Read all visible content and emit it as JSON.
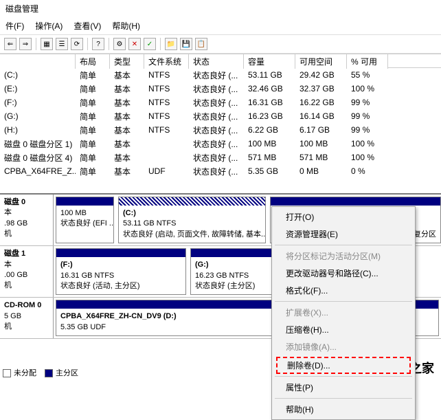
{
  "title": "磁盘管理",
  "menu": {
    "file": "件(F)",
    "action": "操作(A)",
    "view": "查看(V)",
    "help": "帮助(H)"
  },
  "cols": {
    "vol": "",
    "layout": "布局",
    "type": "类型",
    "fs": "文件系统",
    "status": "状态",
    "cap": "容量",
    "free": "可用空间",
    "pct": "% 可用"
  },
  "rows": [
    {
      "vol": "(C:)",
      "layout": "简单",
      "type": "基本",
      "fs": "NTFS",
      "status": "状态良好 (...",
      "cap": "53.11 GB",
      "free": "29.42 GB",
      "pct": "55 %"
    },
    {
      "vol": "(E:)",
      "layout": "简单",
      "type": "基本",
      "fs": "NTFS",
      "status": "状态良好 (...",
      "cap": "32.46 GB",
      "free": "32.37 GB",
      "pct": "100 %"
    },
    {
      "vol": "(F:)",
      "layout": "简单",
      "type": "基本",
      "fs": "NTFS",
      "status": "状态良好 (...",
      "cap": "16.31 GB",
      "free": "16.22 GB",
      "pct": "99 %"
    },
    {
      "vol": "(G:)",
      "layout": "简单",
      "type": "基本",
      "fs": "NTFS",
      "status": "状态良好 (...",
      "cap": "16.23 GB",
      "free": "16.14 GB",
      "pct": "99 %"
    },
    {
      "vol": "(H:)",
      "layout": "简单",
      "type": "基本",
      "fs": "NTFS",
      "status": "状态良好 (...",
      "cap": "6.22 GB",
      "free": "6.17 GB",
      "pct": "99 %"
    },
    {
      "vol": "磁盘 0 磁盘分区 1)",
      "layout": "简单",
      "type": "基本",
      "fs": "",
      "status": "状态良好 (...",
      "cap": "100 MB",
      "free": "100 MB",
      "pct": "100 %"
    },
    {
      "vol": "磁盘 0 磁盘分区 4)",
      "layout": "简单",
      "type": "基本",
      "fs": "",
      "status": "状态良好 (...",
      "cap": "571 MB",
      "free": "571 MB",
      "pct": "100 %"
    },
    {
      "vol": "CPBA_X64FRE_Z...",
      "layout": "简单",
      "type": "基本",
      "fs": "UDF",
      "status": "状态良好 (...",
      "cap": "5.35 GB",
      "free": "0 MB",
      "pct": "0 %"
    }
  ],
  "disk0": {
    "name": "磁盘 0",
    "type": "本",
    "size": ".98 GB",
    "state": "机",
    "p1": {
      "size": "100 MB",
      "status": "状态良好 (EFI ..."
    },
    "p2": {
      "letter": "(C:)",
      "size": "53.11 GB NTFS",
      "status": "状态良好 (启动, 页面文件, 故障转储, 基本..."
    },
    "p3": {
      "status": "状态良好 (恢复分区"
    }
  },
  "disk1": {
    "name": "磁盘 1",
    "type": "本",
    "size": ".00 GB",
    "state": "机",
    "p1": {
      "letter": "(F:)",
      "size": "16.31 GB NTFS",
      "status": "状态良好 (活动, 主分区)"
    },
    "p2": {
      "letter": "(G:)",
      "size": "16.23 GB NTFS",
      "status": "状态良好 (主分区)"
    }
  },
  "cdrom": {
    "name": "CD-ROM 0",
    "type": "",
    "size": "5 GB",
    "state": "机",
    "p1": {
      "label": "CPBA_X64FRE_ZH-CN_DV9  (D:)",
      "size": "5.35 GB UDF"
    }
  },
  "ctx": {
    "open": "打开(O)",
    "explorer": "资源管理器(E)",
    "active": "将分区标记为活动分区(M)",
    "change": "更改驱动器号和路径(C)...",
    "format": "格式化(F)...",
    "extend": "扩展卷(X)...",
    "shrink": "压缩卷(H)...",
    "mirror": "添加镜像(A)...",
    "delete": "删除卷(D)...",
    "props": "属性(P)",
    "help": "帮助(H)"
  },
  "legend": {
    "unalloc": "未分配",
    "primary": "主分区"
  },
  "logo": "win11系统之家"
}
